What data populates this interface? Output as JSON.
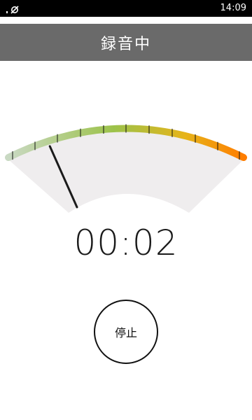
{
  "status_bar": {
    "time": "14:09"
  },
  "header": {
    "title": "録音中"
  },
  "meter": {
    "level_fraction": 0.08,
    "colors": {
      "low": "#c9d9c3",
      "mid": "#9cc24a",
      "high": "#e6b41a",
      "peak": "#ff7d00",
      "face": "#efedee",
      "needle": "#1b1b1b"
    }
  },
  "recorder": {
    "elapsed": "00:02",
    "stop_label": "停止"
  }
}
